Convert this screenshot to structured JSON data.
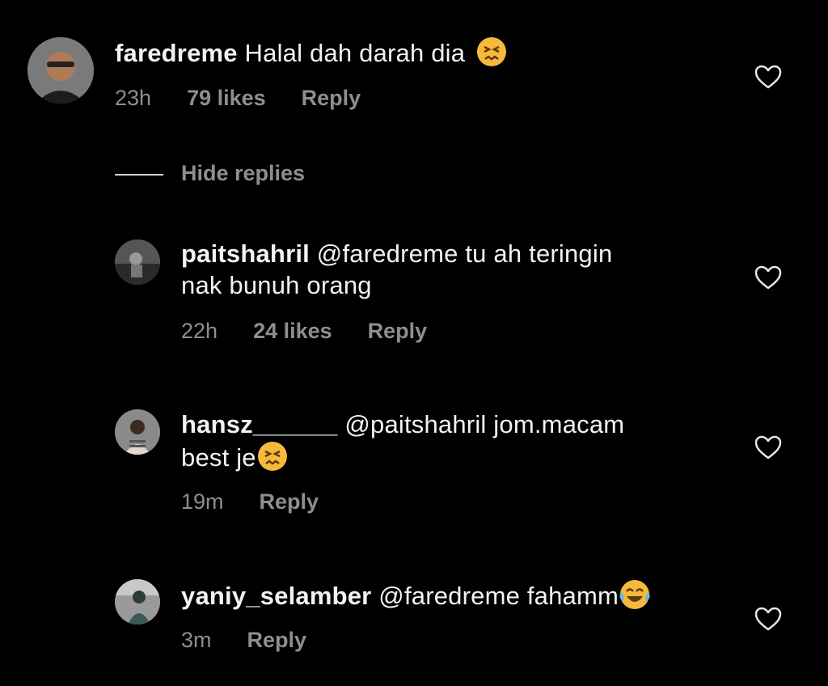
{
  "comments": [
    {
      "username": "faredreme",
      "text": "Halal dah darah dia",
      "time": "23h",
      "likes": "79 likes",
      "reply": "Reply",
      "emoji": "confounded-face"
    },
    {
      "username": "paitshahril",
      "text": "@faredreme tu ah teringin",
      "text2": "nak bunuh orang",
      "time": "22h",
      "likes": "24 likes",
      "reply": "Reply"
    },
    {
      "username": "hansz______",
      "text": "@paitshahril jom.macam",
      "text2": "best je",
      "time": "19m",
      "reply": "Reply",
      "emoji": "confounded-face"
    },
    {
      "username": "yaniy_selamber",
      "text": "@faredreme fahamm",
      "time": "3m",
      "reply": "Reply",
      "emoji": "face-with-tears-of-joy"
    }
  ],
  "hide_replies": "Hide replies",
  "colors": {
    "background": "#000000",
    "text": "#f2f2f2",
    "meta": "#8e8e8e",
    "emoji": "#f6b93b"
  }
}
